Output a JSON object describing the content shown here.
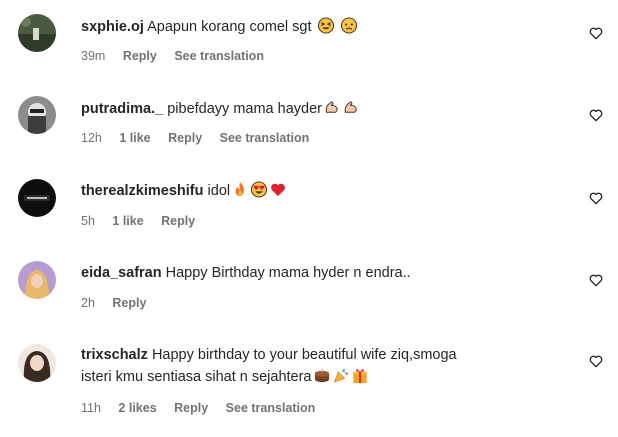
{
  "comments": [
    {
      "username": "sxphie.oj",
      "text": "Apapun korang comel sgt",
      "emojis": [
        "laughing-face",
        "worried-face"
      ],
      "time": "39m",
      "likes": "",
      "reply": "Reply",
      "translate": "See translation"
    },
    {
      "username": "putradima._",
      "text": "pibefdayy mama hayder",
      "emojis": [
        "flexed-biceps",
        "flexed-biceps"
      ],
      "time": "12h",
      "likes": "1 like",
      "reply": "Reply",
      "translate": "See translation"
    },
    {
      "username": "therealzkimeshifu",
      "text": "idol",
      "emojis": [
        "fire",
        "heart-eyes",
        "red-heart"
      ],
      "time": "5h",
      "likes": "1 like",
      "reply": "Reply",
      "translate": ""
    },
    {
      "username": "eida_safran",
      "text": "Happy Birthday mama hyder n endra..",
      "emojis": [],
      "time": "2h",
      "likes": "",
      "reply": "Reply",
      "translate": ""
    },
    {
      "username": "trixschalz",
      "text_line1": "Happy birthday to your beautiful wife ziq,smoga",
      "text_line2": "isteri kmu sentiasa sihat n sejahtera",
      "emojis": [
        "birthday-cake",
        "party-popper",
        "gift"
      ],
      "time": "11h",
      "likes": "2 likes",
      "reply": "Reply",
      "translate": "See translation"
    }
  ]
}
